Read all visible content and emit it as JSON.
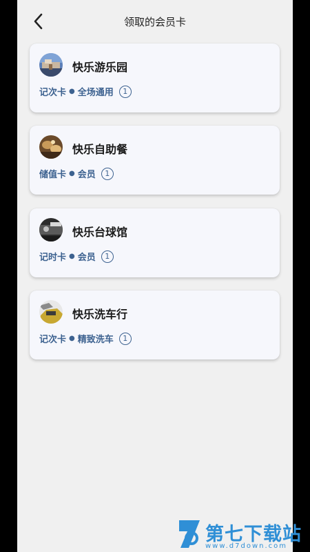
{
  "header": {
    "title": "领取的会员卡",
    "back_icon": "chevron-left-icon"
  },
  "cards": [
    {
      "name": "快乐游乐园",
      "type": "记次卡",
      "scope": "全场通用",
      "count": "1",
      "avatar": "amusement-park-photo"
    },
    {
      "name": "快乐自助餐",
      "type": "储值卡",
      "scope": "会员",
      "count": "1",
      "avatar": "buffet-photo"
    },
    {
      "name": "快乐台球馆",
      "type": "记时卡",
      "scope": "会员",
      "count": "1",
      "avatar": "billiards-photo"
    },
    {
      "name": "快乐洗车行",
      "type": "记次卡",
      "scope": "精致洗车",
      "count": "1",
      "avatar": "car-wash-photo"
    }
  ],
  "watermark": {
    "name": "第七下载站",
    "url": "www.d7down.com"
  },
  "colors": {
    "background": "#f0f0f0",
    "card": "#f6f7fc",
    "meta_text": "#3d6290",
    "watermark": "#2f8fd6"
  }
}
